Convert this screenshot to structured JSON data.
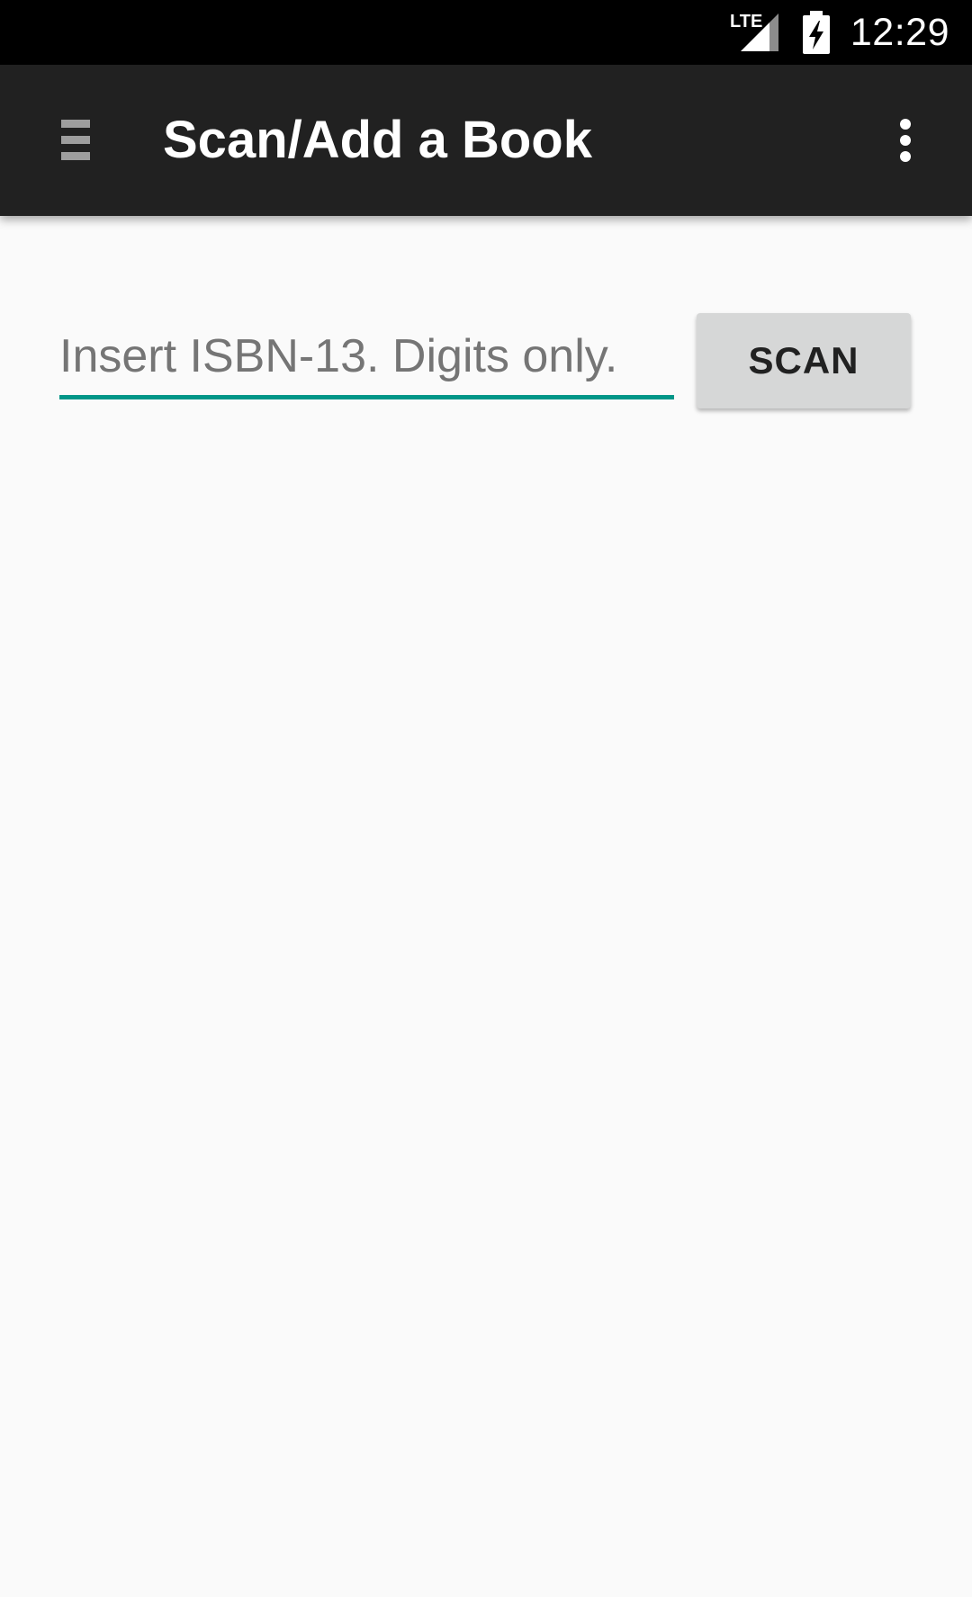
{
  "status_bar": {
    "network_label": "LTE",
    "time": "12:29",
    "icons": [
      "lte-signal-icon",
      "battery-charging-icon"
    ]
  },
  "app_bar": {
    "title": "Scan/Add a Book",
    "icons": [
      "menu-icon",
      "overflow-menu-icon"
    ],
    "background_color": "#212121"
  },
  "isbn": {
    "value": "",
    "placeholder": "Insert ISBN-13. Digits only.",
    "underline_color": "#009688"
  },
  "scan_button": {
    "label": "SCAN",
    "background_color": "#d6d7d7"
  }
}
